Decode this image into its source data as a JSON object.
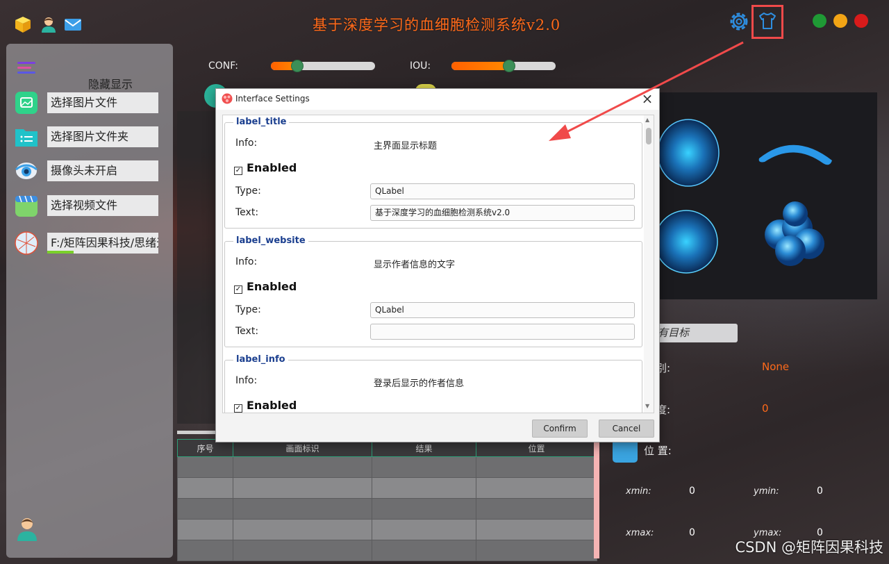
{
  "header": {
    "title": "基于深度学习的血细胞检测系统v2.0",
    "icons": [
      "cube-icon",
      "user-icon",
      "mail-icon",
      "gear-icon",
      "shirt-icon"
    ],
    "window_controls": {
      "colors": [
        "#1f9a35",
        "#f2a415",
        "#d81b1b"
      ]
    }
  },
  "sidebar": {
    "toggle_label": "隐藏显示",
    "items": [
      {
        "label": "选择图片文件",
        "icon": "image-icon"
      },
      {
        "label": "选择图片文件夹",
        "icon": "folder-icon"
      },
      {
        "label": "摄像头未开启",
        "icon": "camera-icon"
      },
      {
        "label": "选择视频文件",
        "icon": "video-icon"
      },
      {
        "label": "F:/矩阵因果科技/思绪无限",
        "icon": "network-icon",
        "progress": 0.24
      }
    ]
  },
  "sliders": {
    "conf": {
      "label": "CONF:",
      "value": 0.25
    },
    "iou": {
      "label": "IOU:",
      "value": 0.55
    }
  },
  "results": {
    "target_button": "有目标",
    "class_label": "别:",
    "class_value": "None",
    "conf_label": "信度:",
    "conf_value": "0",
    "position_label": "位 置:",
    "coords": {
      "xmin_label": "xmin:",
      "xmin": "0",
      "ymin_label": "ymin:",
      "ymin": "0",
      "xmax_label": "xmax:",
      "xmax": "0",
      "ymax_label": "ymax:",
      "ymax": "0"
    }
  },
  "table": {
    "headers": [
      "序号",
      "画面标识",
      "结果",
      "位置"
    ]
  },
  "watermark": "CSDN @矩阵因果科技",
  "dialog": {
    "title": "Interface Settings",
    "info_label": "Info:",
    "enabled_label": "Enabled",
    "type_label": "Type:",
    "text_label": "Text:",
    "groups": [
      {
        "name": "label_title",
        "info": "主界面显示标题",
        "enabled": true,
        "type": "QLabel",
        "text": "基于深度学习的血细胞检测系统v2.0"
      },
      {
        "name": "label_website",
        "info": "显示作者信息的文字",
        "enabled": true,
        "type": "QLabel",
        "text": ""
      },
      {
        "name": "label_info",
        "info": "登录后显示的作者信息",
        "enabled": true
      }
    ],
    "confirm_label": "Confirm",
    "cancel_label": "Cancel"
  }
}
